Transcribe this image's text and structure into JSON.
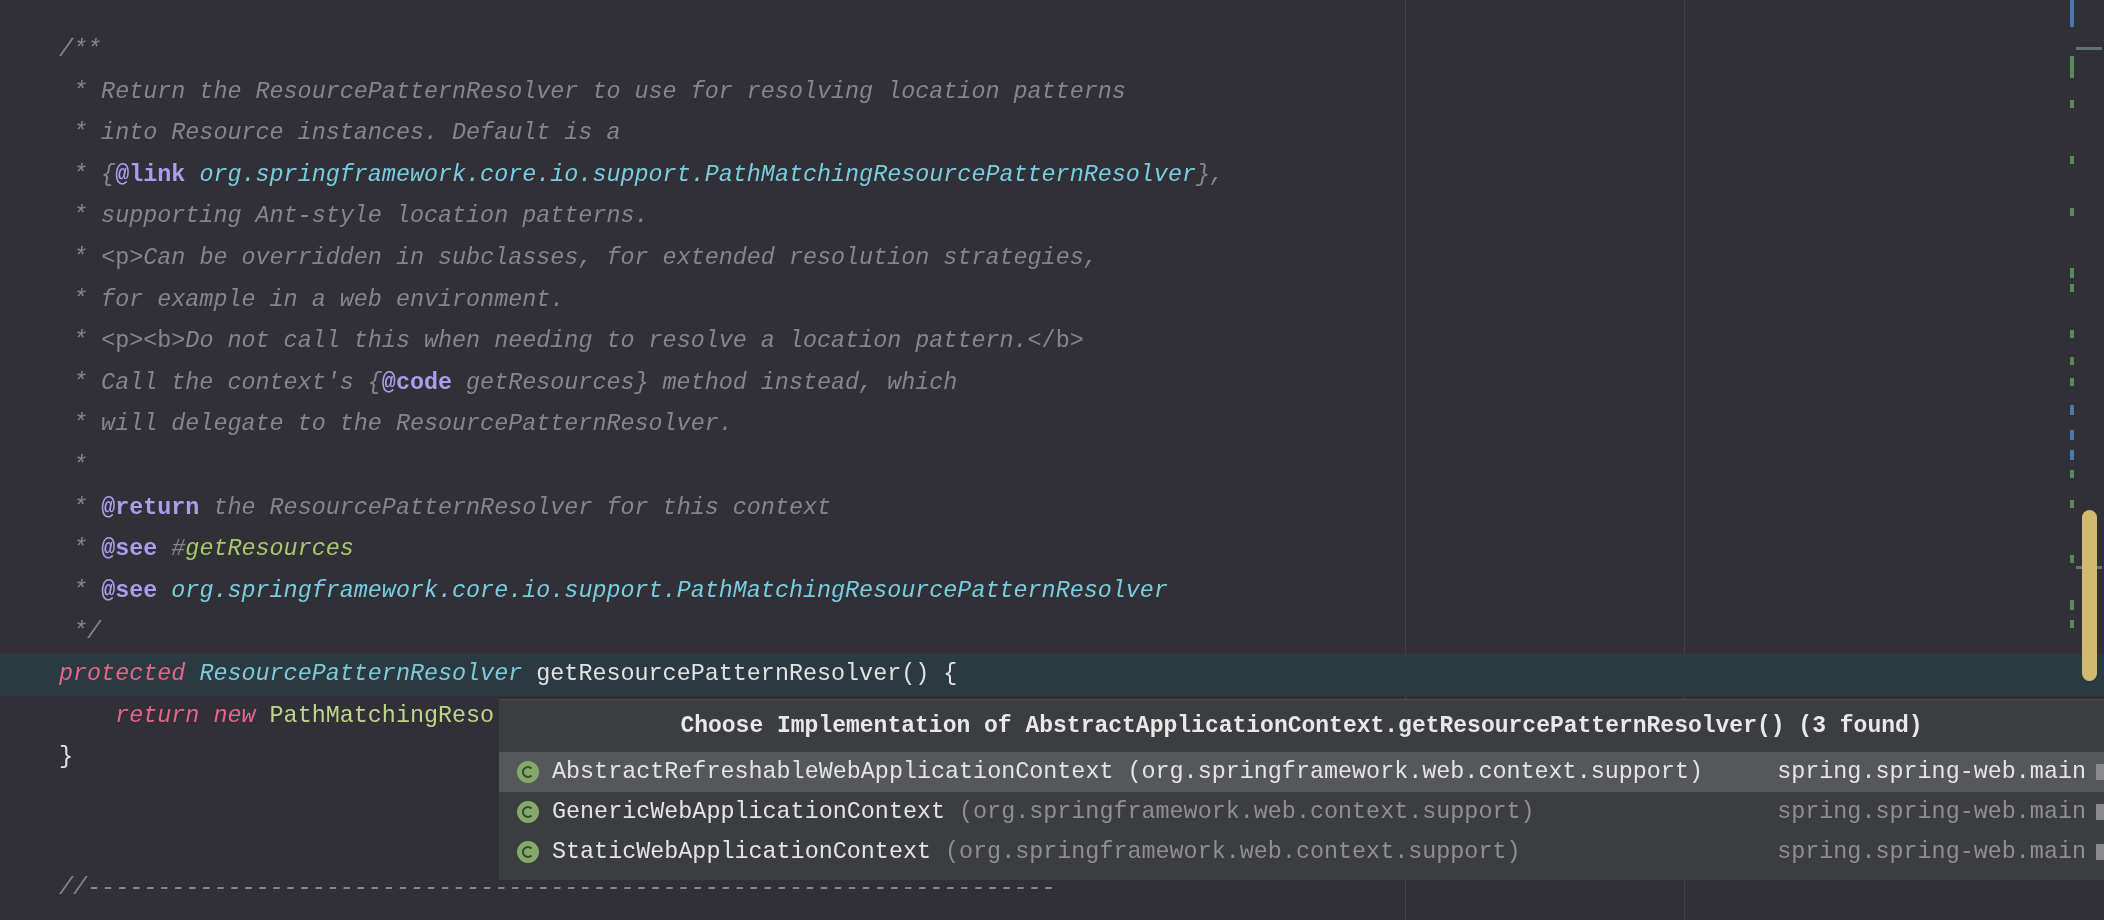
{
  "code_lines": [
    {
      "kind": "text",
      "current": false,
      "tokens": [
        {
          "kind": "comment",
          "text": "/**"
        }
      ]
    },
    {
      "kind": "text",
      "current": false,
      "tokens": [
        {
          "kind": "comment",
          "text": " * Return the ResourcePatternResolver to use for resolving location patterns"
        }
      ]
    },
    {
      "kind": "text",
      "current": false,
      "tokens": [
        {
          "kind": "comment",
          "text": " * into Resource instances. Default is a"
        }
      ]
    },
    {
      "kind": "text",
      "current": false,
      "tokens": [
        {
          "kind": "comment",
          "text": " * {"
        },
        {
          "kind": "tag",
          "text": "@link"
        },
        {
          "kind": "link",
          "text": " org.springframework.core.io.support.PathMatchingResourcePatternResolver"
        },
        {
          "kind": "comment",
          "text": "},"
        }
      ]
    },
    {
      "kind": "text",
      "current": false,
      "tokens": [
        {
          "kind": "comment",
          "text": " * supporting Ant-style location patterns."
        }
      ]
    },
    {
      "kind": "text",
      "current": false,
      "tokens": [
        {
          "kind": "comment",
          "text": " * "
        },
        {
          "kind": "markup",
          "text": "<p>"
        },
        {
          "kind": "comment",
          "text": "Can be overridden in subclasses, for extended resolution strategies,"
        }
      ]
    },
    {
      "kind": "text",
      "current": false,
      "tokens": [
        {
          "kind": "comment",
          "text": " * for example in a web environment."
        }
      ]
    },
    {
      "kind": "text",
      "current": false,
      "tokens": [
        {
          "kind": "comment",
          "text": " * "
        },
        {
          "kind": "markup",
          "text": "<p><b>"
        },
        {
          "kind": "comment",
          "text": "Do not call this when needing to resolve a location pattern."
        },
        {
          "kind": "markup",
          "text": "</b>"
        }
      ]
    },
    {
      "kind": "text",
      "current": false,
      "tokens": [
        {
          "kind": "comment",
          "text": " * Call the context's {"
        },
        {
          "kind": "tag",
          "text": "@code"
        },
        {
          "kind": "comment",
          "text": " getResources} method instead, which"
        }
      ]
    },
    {
      "kind": "text",
      "current": false,
      "tokens": [
        {
          "kind": "comment",
          "text": " * will delegate to the ResourcePatternResolver."
        }
      ]
    },
    {
      "kind": "text",
      "current": false,
      "tokens": [
        {
          "kind": "comment",
          "text": " *"
        }
      ]
    },
    {
      "kind": "text",
      "current": false,
      "tokens": [
        {
          "kind": "comment",
          "text": " * "
        },
        {
          "kind": "tag",
          "text": "@return"
        },
        {
          "kind": "comment",
          "text": " the ResourcePatternResolver for this context"
        }
      ]
    },
    {
      "kind": "text",
      "current": false,
      "tokens": [
        {
          "kind": "comment",
          "text": " * "
        },
        {
          "kind": "tag",
          "text": "@see"
        },
        {
          "kind": "comment",
          "text": " #"
        },
        {
          "kind": "ref",
          "text": "getResources"
        }
      ]
    },
    {
      "kind": "text",
      "current": false,
      "tokens": [
        {
          "kind": "comment",
          "text": " * "
        },
        {
          "kind": "tag",
          "text": "@see"
        },
        {
          "kind": "link",
          "text": " org.springframework.core.io.support.PathMatchingResourcePatternResolver"
        }
      ]
    },
    {
      "kind": "text",
      "current": false,
      "tokens": [
        {
          "kind": "comment",
          "text": " */"
        }
      ]
    },
    {
      "kind": "text",
      "current": true,
      "tokens": [
        {
          "kind": "keyword",
          "text": "protected"
        },
        {
          "kind": "type",
          "text": " ResourcePatternResolver"
        },
        {
          "kind": "plain",
          "text": " getResourcePatternResolver() {"
        }
      ]
    },
    {
      "kind": "text",
      "current": false,
      "tokens": [
        {
          "kind": "keyword",
          "text": "    return new"
        },
        {
          "kind": "constructor",
          "text": " PathMatchingReso"
        }
      ]
    },
    {
      "kind": "text",
      "current": false,
      "tokens": [
        {
          "kind": "plain",
          "text": "}"
        }
      ]
    },
    {
      "kind": "text",
      "current": false,
      "tokens": [
        {
          "kind": "comment",
          "text": "//---------------------------------------------------------------------"
        }
      ]
    }
  ],
  "popup": {
    "title": "Choose Implementation of AbstractApplicationContext.getResourcePatternResolver() (3 found)",
    "items": [
      {
        "name": "AbstractRefreshableWebApplicationContext",
        "package": "(org.springframework.web.context.support)",
        "module": "spring.spring-web.main",
        "selected": true
      },
      {
        "name": "GenericWebApplicationContext",
        "package": "(org.springframework.web.context.support)",
        "module": "spring.spring-web.main",
        "selected": false
      },
      {
        "name": "StaticWebApplicationContext",
        "package": "(org.springframework.web.context.support)",
        "module": "spring.spring-web.main",
        "selected": false
      }
    ]
  }
}
